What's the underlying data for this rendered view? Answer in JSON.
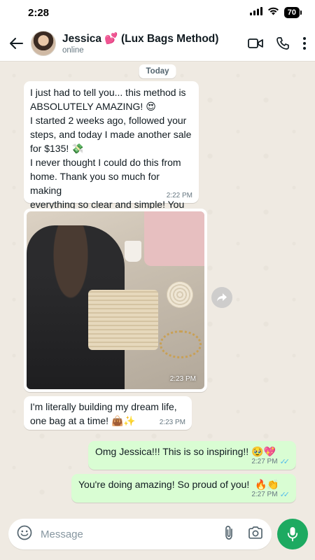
{
  "status_bar": {
    "time": "2:28",
    "battery": "70"
  },
  "header": {
    "name": "Jessica 💕 (Lux Bags Method)",
    "status": "online"
  },
  "chat": {
    "date_chip": "Today",
    "messages": [
      {
        "text": "I just had to tell you... this method is\nABSOLUTELY AMAZING! 😍\nI started 2 weeks ago, followed your\nsteps, and today I made another sale\nfor $135! 💸\nI never thought I could do this from\nhome. Thank you so much for making\neverything so clear and simple! You\nchanged my life! 🥹❤️",
        "time": "2:22 PM"
      },
      {
        "photo_time": "2:23 PM"
      },
      {
        "text": "I'm literally building my dream life,\none bag at a time! 👜✨",
        "time": "2:23 PM"
      },
      {
        "text": "Omg Jessica!!! This is so inspiring!! 🥹💖",
        "time": "2:27 PM"
      },
      {
        "text": "You're doing amazing! So proud of you!  🔥👏",
        "time": "2:27 PM"
      }
    ]
  },
  "input": {
    "placeholder": "Message"
  },
  "colors": {
    "accent": "#1daa61",
    "outgoing_bubble": "#d9fdd3",
    "incoming_bubble": "#ffffff",
    "read_ticks": "#53bdeb"
  },
  "icons": [
    "signal-icon",
    "wifi-icon",
    "back-arrow-icon",
    "video-call-icon",
    "phone-icon",
    "more-options-icon",
    "forward-icon",
    "emoji-icon",
    "attach-icon",
    "camera-icon",
    "mic-icon"
  ]
}
